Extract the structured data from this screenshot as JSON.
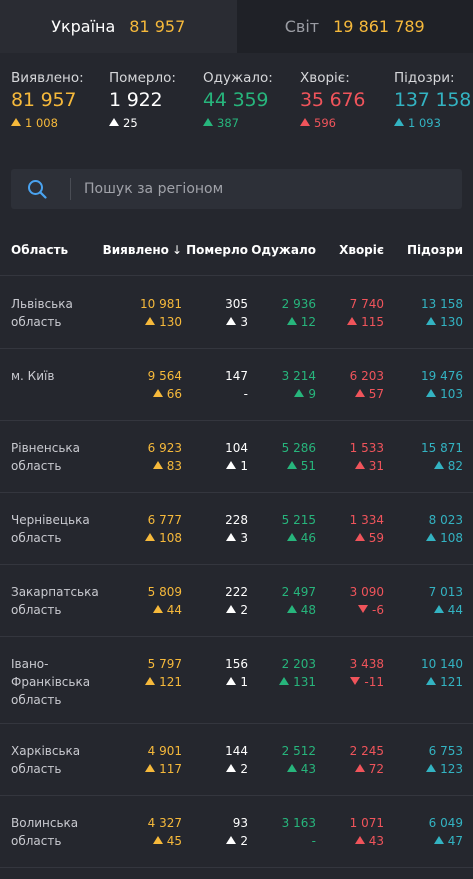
{
  "tabs": [
    {
      "name": "Україна",
      "count": "81 957",
      "active": true
    },
    {
      "name": "Світ",
      "count": "19 861 789",
      "active": false
    }
  ],
  "summary": [
    {
      "label": "Виявлено:",
      "value": "81 957",
      "delta": "1 008",
      "dir": "up",
      "color": "#f6b93b"
    },
    {
      "label": "Померло:",
      "value": "1 922",
      "delta": "25",
      "dir": "up",
      "color": "#ffffff"
    },
    {
      "label": "Одужало:",
      "value": "44 359",
      "delta": "387",
      "dir": "up",
      "color": "#27b57c"
    },
    {
      "label": "Хворіє:",
      "value": "35 676",
      "delta": "596",
      "dir": "up",
      "color": "#f0545b"
    },
    {
      "label": "Підозри:",
      "value": "137 158",
      "delta": "1 093",
      "dir": "up",
      "color": "#33b3c2"
    }
  ],
  "search": {
    "placeholder": "Пошук за регіоном",
    "icon": "search-icon"
  },
  "table": {
    "headers": [
      "Область",
      "Виявлено",
      "Померло",
      "Одужало",
      "Хворіє",
      "Підозри"
    ],
    "sort_indicator": "↓",
    "rows": [
      {
        "region": "Львівська область",
        "lines": 2,
        "values": [
          "10 981",
          "305",
          "2 936",
          "7 740",
          "13 158"
        ],
        "deltas": [
          "130",
          "3",
          "12",
          "115",
          "130"
        ],
        "dirs": [
          "up",
          "up",
          "up",
          "up",
          "up"
        ]
      },
      {
        "region": "м. Київ",
        "lines": 2,
        "values": [
          "9 564",
          "147",
          "3 214",
          "6 203",
          "19 476"
        ],
        "deltas": [
          "66",
          "-",
          "9",
          "57",
          "103"
        ],
        "dirs": [
          "up",
          "none",
          "up",
          "up",
          "up"
        ]
      },
      {
        "region": "Рівненська область",
        "lines": 2,
        "values": [
          "6 923",
          "104",
          "5 286",
          "1 533",
          "15 871"
        ],
        "deltas": [
          "83",
          "1",
          "51",
          "31",
          "82"
        ],
        "dirs": [
          "up",
          "up",
          "up",
          "up",
          "up"
        ]
      },
      {
        "region": "Чернівецька область",
        "lines": 2,
        "values": [
          "6 777",
          "228",
          "5 215",
          "1 334",
          "8 023"
        ],
        "deltas": [
          "108",
          "3",
          "46",
          "59",
          "108"
        ],
        "dirs": [
          "up",
          "up",
          "up",
          "up",
          "up"
        ]
      },
      {
        "region": "Закарпатська область",
        "lines": 2,
        "values": [
          "5 809",
          "222",
          "2 497",
          "3 090",
          "7 013"
        ],
        "deltas": [
          "44",
          "2",
          "48",
          "-6",
          "44"
        ],
        "dirs": [
          "up",
          "up",
          "up",
          "down",
          "up"
        ]
      },
      {
        "region": "Івано-Франківська область",
        "lines": 3,
        "values": [
          "5 797",
          "156",
          "2 203",
          "3 438",
          "10 140"
        ],
        "deltas": [
          "121",
          "1",
          "131",
          "-11",
          "121"
        ],
        "dirs": [
          "up",
          "up",
          "up",
          "down",
          "up"
        ]
      },
      {
        "region": "Харківська область",
        "lines": 2,
        "values": [
          "4 901",
          "144",
          "2 512",
          "2 245",
          "6 753"
        ],
        "deltas": [
          "117",
          "2",
          "43",
          "72",
          "123"
        ],
        "dirs": [
          "up",
          "up",
          "up",
          "up",
          "up"
        ]
      },
      {
        "region": "Волинська область",
        "lines": 2,
        "values": [
          "4 327",
          "93",
          "3 163",
          "1 071",
          "6 049"
        ],
        "deltas": [
          "45",
          "2",
          "-",
          "43",
          "47"
        ],
        "dirs": [
          "up",
          "up",
          "none",
          "up",
          "up"
        ]
      }
    ]
  },
  "colors": {
    "confirmed": "#f6b93b",
    "deaths": "#ffffff",
    "recovered": "#27b57c",
    "sick": "#f0545b",
    "suspected": "#33b3c2",
    "background": "#25272e"
  }
}
